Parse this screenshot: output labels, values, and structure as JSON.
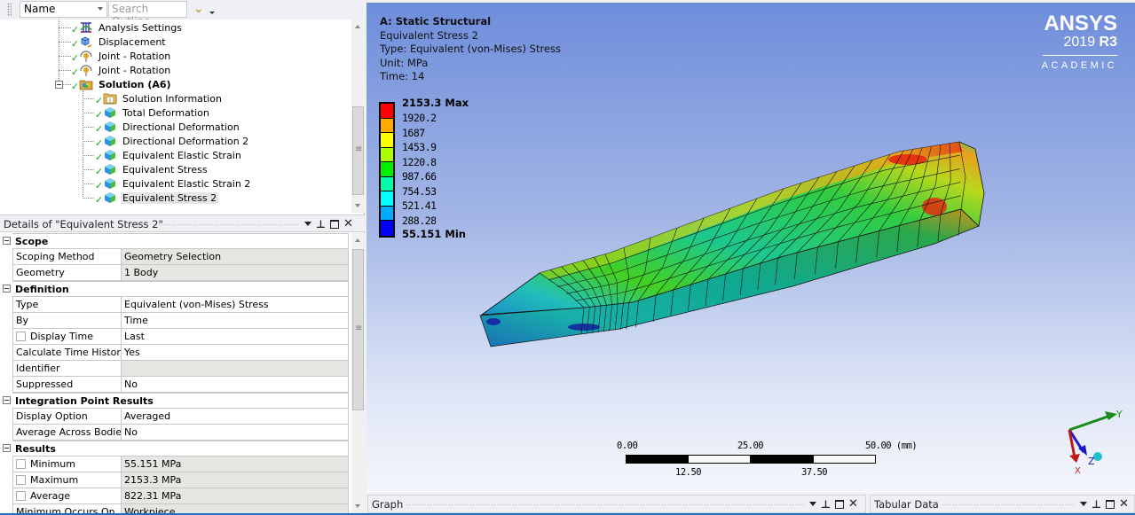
{
  "toolbar": {
    "name_select": "Name",
    "search_placeholder": "Search Outline"
  },
  "tree": {
    "items": [
      {
        "label": "Analysis Settings",
        "icon": "analysis-settings-icon",
        "status": "check"
      },
      {
        "label": "Displacement",
        "icon": "displacement-icon",
        "status": "check"
      },
      {
        "label": "Joint - Rotation",
        "icon": "joint-rotation-icon",
        "status": "check"
      },
      {
        "label": "Joint - Rotation",
        "icon": "joint-rotation-icon",
        "status": "check"
      },
      {
        "label": "Solution (A6)",
        "icon": "solution-folder-icon",
        "status": "check",
        "bold": true,
        "expanded": true
      },
      {
        "label": "Solution Information",
        "icon": "solution-information-icon",
        "status": "check"
      },
      {
        "label": "Total Deformation",
        "icon": "result-icon",
        "status": "check"
      },
      {
        "label": "Directional Deformation",
        "icon": "result-icon",
        "status": "check"
      },
      {
        "label": "Directional Deformation 2",
        "icon": "result-icon",
        "status": "check"
      },
      {
        "label": "Equivalent Elastic Strain",
        "icon": "result-icon",
        "status": "check"
      },
      {
        "label": "Equivalent Stress",
        "icon": "result-icon",
        "status": "check"
      },
      {
        "label": "Equivalent Elastic Strain 2",
        "icon": "result-icon",
        "status": "check"
      },
      {
        "label": "Equivalent Stress 2",
        "icon": "result-icon",
        "status": "check",
        "selected": true
      }
    ]
  },
  "details": {
    "title": "Details of \"Equivalent Stress 2\"",
    "categories": {
      "scope": "Scope",
      "definition": "Definition",
      "integration": "Integration Point Results",
      "results": "Results"
    },
    "rows": {
      "scoping_method": {
        "key": "Scoping Method",
        "value": "Geometry Selection"
      },
      "geometry": {
        "key": "Geometry",
        "value": "1 Body"
      },
      "type": {
        "key": "Type",
        "value": "Equivalent (von-Mises) Stress"
      },
      "by": {
        "key": "By",
        "value": "Time"
      },
      "display_time": {
        "key": "Display Time",
        "value": "Last"
      },
      "calc_time_history": {
        "key": "Calculate Time History",
        "value": "Yes"
      },
      "identifier": {
        "key": "Identifier",
        "value": ""
      },
      "suppressed": {
        "key": "Suppressed",
        "value": "No"
      },
      "display_option": {
        "key": "Display Option",
        "value": "Averaged"
      },
      "avg_across_bodies": {
        "key": "Average Across Bodies",
        "value": "No"
      },
      "minimum": {
        "key": "Minimum",
        "value": "55.151 MPa"
      },
      "maximum": {
        "key": "Maximum",
        "value": "2153.3 MPa"
      },
      "average": {
        "key": "Average",
        "value": "822.31 MPa"
      },
      "min_occurs_on": {
        "key": "Minimum Occurs On",
        "value": "Workpiece"
      }
    }
  },
  "viewport": {
    "info": {
      "system": "A: Static Structural",
      "result": "Equivalent Stress 2",
      "type": "Type: Equivalent (von-Mises) Stress",
      "unit": "Unit: MPa",
      "time": "Time: 14"
    },
    "legend": {
      "max_label": "2153.3 Max",
      "min_label": "55.151 Min",
      "levels": [
        "1920.2",
        "1687",
        "1453.9",
        "1220.8",
        "987.66",
        "754.53",
        "521.41",
        "288.28"
      ],
      "colors": [
        "#ff0000",
        "#ffaa00",
        "#ffff00",
        "#aaff00",
        "#00ee00",
        "#00ffaa",
        "#00ffff",
        "#00aaff",
        "#0000ff"
      ]
    },
    "brand": {
      "name": "ANSYS",
      "year": "2019",
      "release": "R3",
      "edition": "ACADEMIC"
    },
    "scale_bar": {
      "top_labels": [
        "0.00",
        "25.00",
        "50.00 (mm)"
      ],
      "bottom_labels": [
        "12.50",
        "37.50"
      ]
    },
    "triad": {
      "x": "X",
      "y": "Y",
      "z": "Z"
    }
  },
  "bottom_panes": {
    "graph": "Graph",
    "tabular": "Tabular Data"
  },
  "colors": {
    "accent_blue": "#1c6fc2",
    "check_green": "#1f9e1f"
  }
}
